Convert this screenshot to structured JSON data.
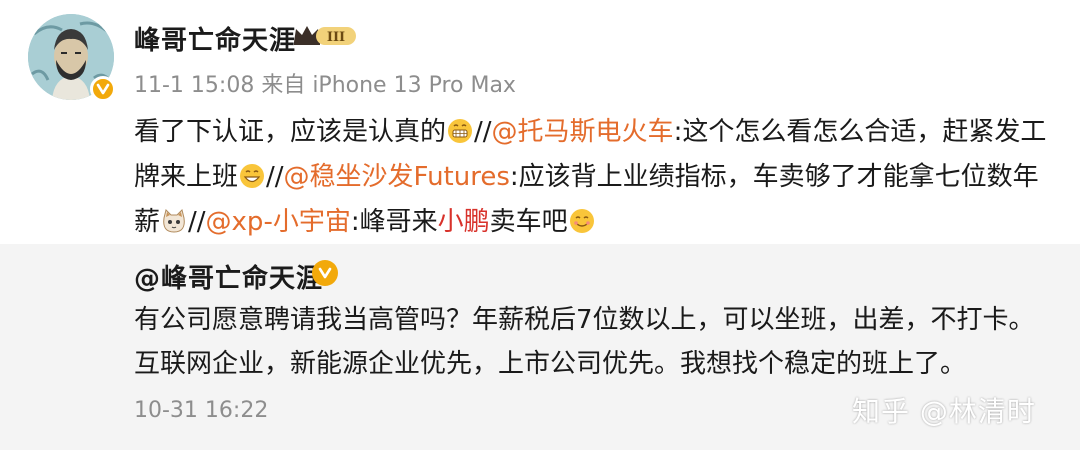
{
  "post": {
    "username": "峰哥亡命天涯",
    "vip_level": "III",
    "date": "11-1 15:08",
    "source": "来自 iPhone 13 Pro Max",
    "text_1": "看了下认证，应该是认真的",
    "sep_1": "//",
    "mention_1": "@托马斯电火车",
    "text_2": ":这个怎么看怎么合适，赶紧发工牌来上班",
    "sep_2": "//",
    "mention_2": "@稳坐沙发Futures",
    "text_3": ":应该背上业绩指标，车卖够了才能拿七位数年薪",
    "sep_3": "//",
    "mention_3": "@xp-小宇宙",
    "text_4": ":峰哥来",
    "highlight": "小鹏",
    "text_5": "卖车吧"
  },
  "repost": {
    "username": "@峰哥亡命天涯",
    "text": "有公司愿意聘请我当高管吗？年薪税后7位数以上，可以坐班，出差，不打卡。互联网企业，新能源企业优先，上市公司优先。我想找个稳定的班上了。",
    "time": "10-31 16:22"
  },
  "watermark": "知乎 @林清时",
  "colors": {
    "mention": "#e46c2c",
    "highlight": "#d8322b",
    "meta": "#8d8d8d",
    "badge": "#f2a90b",
    "repost_bg": "#f4f4f4"
  },
  "icons": [
    "avatar",
    "verified-badge-icon",
    "vip-crown-icon",
    "emoji-grin-icon",
    "emoji-smile-icon",
    "emoji-cat-icon",
    "emoji-wink-icon"
  ]
}
